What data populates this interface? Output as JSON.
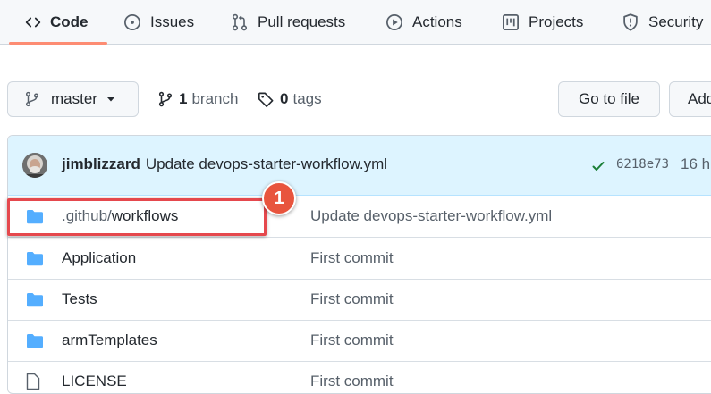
{
  "tabs": [
    {
      "label": "Code",
      "icon": "code-icon",
      "active": true
    },
    {
      "label": "Issues",
      "icon": "issue-icon",
      "active": false
    },
    {
      "label": "Pull requests",
      "icon": "pull-request-icon",
      "active": false
    },
    {
      "label": "Actions",
      "icon": "play-icon",
      "active": false
    },
    {
      "label": "Projects",
      "icon": "project-icon",
      "active": false
    },
    {
      "label": "Security",
      "icon": "shield-icon",
      "active": false
    }
  ],
  "toolbar": {
    "branch_label": "master",
    "branches_count": "1",
    "branches_text": "branch",
    "tags_count": "0",
    "tags_text": "tags",
    "goto_file_label": "Go to file",
    "add_file_label": "Add"
  },
  "latest_commit": {
    "author": "jimblizzard",
    "message": "Update devops-starter-workflow.yml",
    "sha": "6218e73",
    "age": "16 h"
  },
  "files": [
    {
      "name_dim": ".github/",
      "name": "workflows",
      "message": "Update devops-starter-workflow.yml",
      "type": "folder"
    },
    {
      "name_dim": "",
      "name": "Application",
      "message": "First commit",
      "type": "folder"
    },
    {
      "name_dim": "",
      "name": "Tests",
      "message": "First commit",
      "type": "folder"
    },
    {
      "name_dim": "",
      "name": "armTemplates",
      "message": "First commit",
      "type": "folder"
    },
    {
      "name_dim": "",
      "name": "LICENSE",
      "message": "First commit",
      "type": "file"
    }
  ],
  "callout": {
    "number": "1"
  },
  "colors": {
    "accent_underline": "#fd8c73",
    "folder": "#54aeff",
    "callout": "#e5484d",
    "check": "#1a7f37"
  }
}
